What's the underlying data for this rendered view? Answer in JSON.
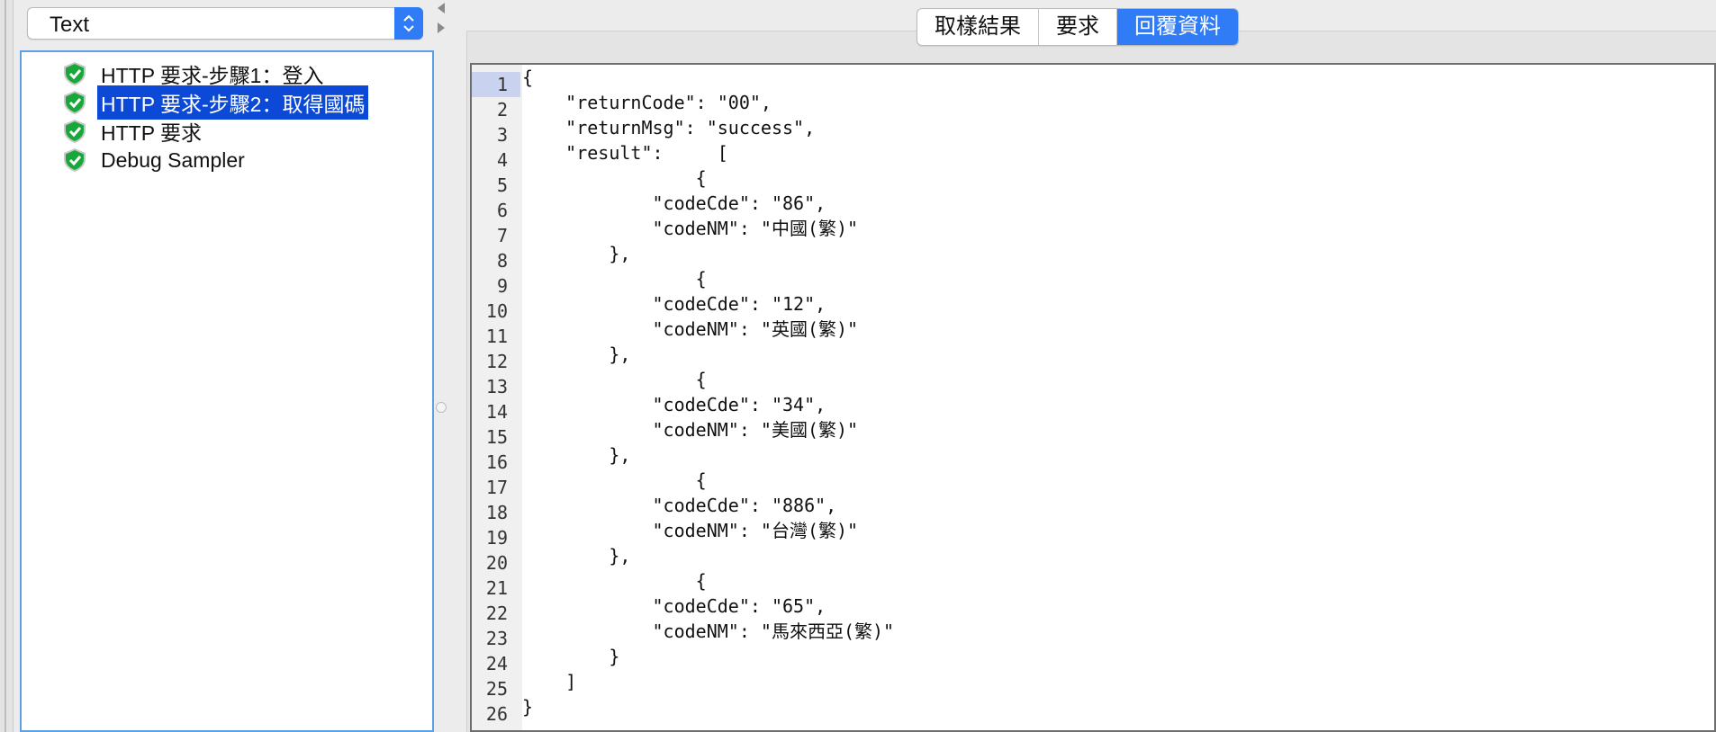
{
  "combo": {
    "value": "Text"
  },
  "tree": {
    "items": [
      {
        "label": "HTTP 要求-步驟1：登入",
        "selected": false
      },
      {
        "label": "HTTP 要求-步驟2：取得國碼",
        "selected": true
      },
      {
        "label": "HTTP 要求",
        "selected": false
      },
      {
        "label": "Debug Sampler",
        "selected": false
      }
    ]
  },
  "tabs": [
    {
      "label": "取樣結果",
      "active": false
    },
    {
      "label": "要求",
      "active": false
    },
    {
      "label": "回覆資料",
      "active": true
    }
  ],
  "editor": {
    "current_line": "1",
    "line_numbers": [
      "1",
      "2",
      "3",
      "4",
      "5",
      "6",
      "7",
      "8",
      "9",
      "10",
      "11",
      "12",
      "13",
      "14",
      "15",
      "16",
      "17",
      "18",
      "19",
      "20",
      "21",
      "22",
      "23",
      "24",
      "25",
      "26"
    ],
    "lines": [
      "{",
      "    \"returnCode\": \"00\",",
      "    \"returnMsg\": \"success\",",
      "    \"result\":     [",
      "                {",
      "            \"codeCde\": \"86\",",
      "            \"codeNM\": \"中國(繁)\"",
      "        },",
      "                {",
      "            \"codeCde\": \"12\",",
      "            \"codeNM\": \"英國(繁)\"",
      "        },",
      "                {",
      "            \"codeCde\": \"34\",",
      "            \"codeNM\": \"美國(繁)\"",
      "        },",
      "                {",
      "            \"codeCde\": \"886\",",
      "            \"codeNM\": \"台灣(繁)\"",
      "        },",
      "                {",
      "            \"codeCde\": \"65\",",
      "            \"codeNM\": \"馬來西亞(繁)\"",
      "        }",
      "    ]",
      "}"
    ]
  },
  "icons": {
    "tree_item": "success-shield-icon",
    "combo": "updown-chevron-icon",
    "splitter": "arrow-left-right-icon"
  },
  "colors": {
    "accent": "#2f7cf6",
    "selection": "#0b49d6",
    "shield_green": "#18a83a",
    "tree_border": "#5aa1e8"
  }
}
